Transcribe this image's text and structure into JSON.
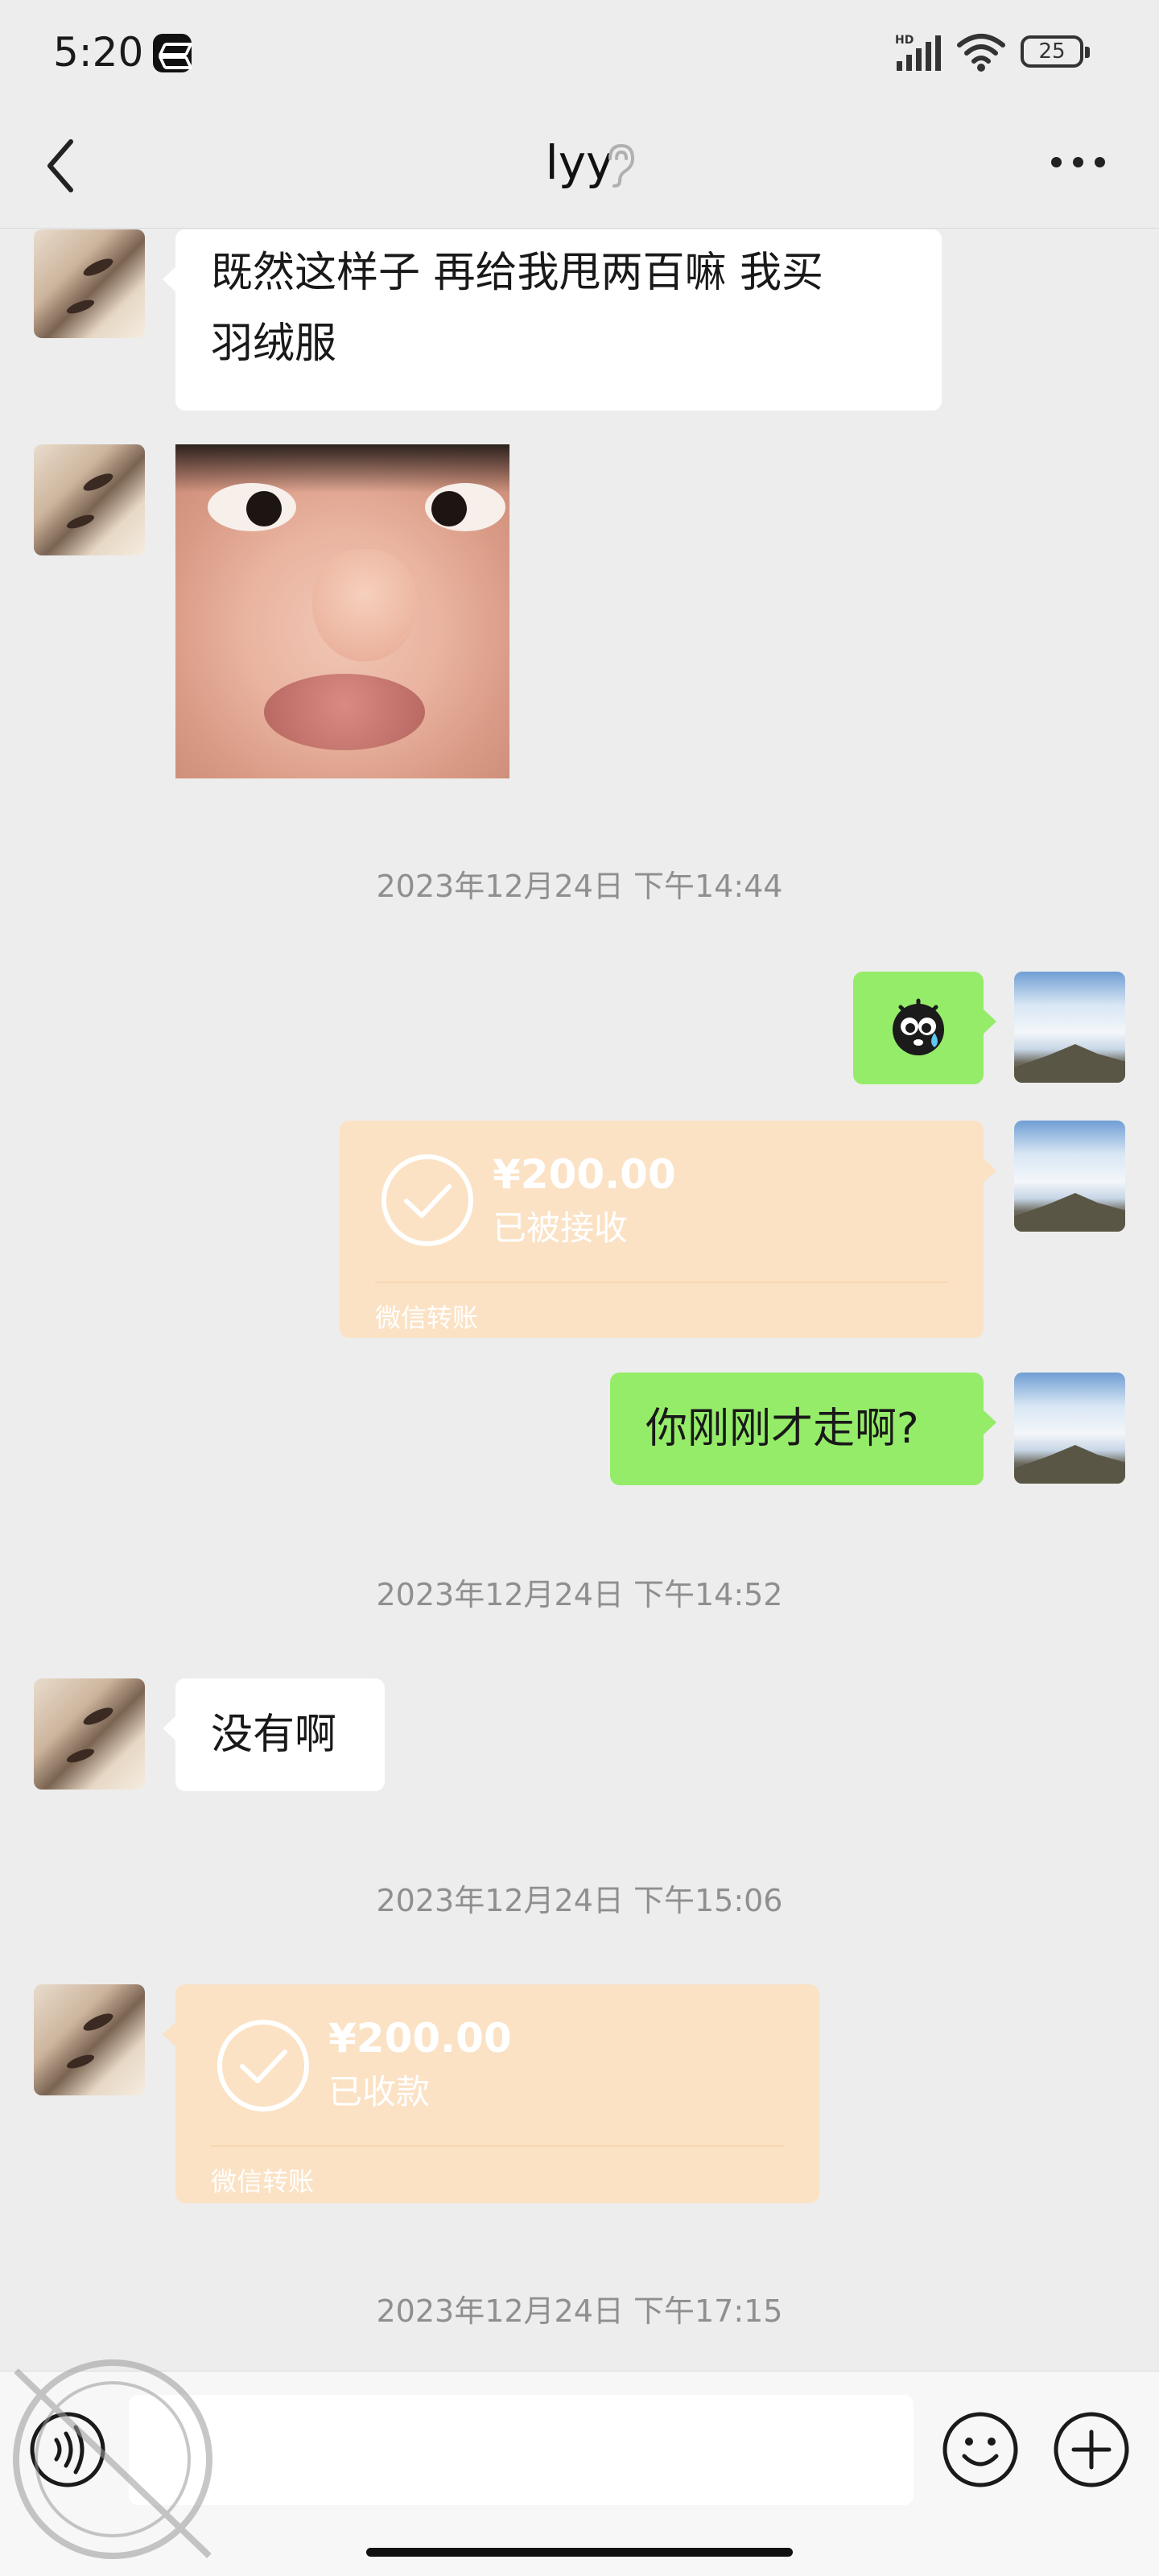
{
  "status_bar": {
    "time": "5:20",
    "battery": "25",
    "network": "HD",
    "icons": [
      "capcut-icon",
      "signal-icon",
      "wifi-icon",
      "battery-icon"
    ]
  },
  "header": {
    "title": "lyy",
    "icons": [
      "back-arrow-icon",
      "ear-icon",
      "more-icon"
    ]
  },
  "messages": [
    {
      "side": "left",
      "type": "text",
      "text_line1": "既然这样子  再给我甩两百嘛 我买",
      "text_line2": "羽绒服"
    },
    {
      "side": "left",
      "type": "image",
      "description": "sticker-photo"
    },
    {
      "type": "timestamp",
      "text": "2023年12月24日 下午14:44"
    },
    {
      "side": "right",
      "type": "emoji",
      "icon": "crying-emoji-icon"
    },
    {
      "side": "right",
      "type": "transfer",
      "amount": "¥200.00",
      "status": "已被接收",
      "label": "微信转账"
    },
    {
      "side": "right",
      "type": "text",
      "text": "你刚刚才走啊?"
    },
    {
      "type": "timestamp",
      "text": "2023年12月24日 下午14:52"
    },
    {
      "side": "left",
      "type": "text",
      "text": "没有啊"
    },
    {
      "type": "timestamp",
      "text": "2023年12月24日 下午15:06"
    },
    {
      "side": "left",
      "type": "transfer",
      "amount": "¥200.00",
      "status": "已收款",
      "label": "微信转账"
    },
    {
      "type": "timestamp",
      "text": "2023年12月24日 下午17:15"
    }
  ],
  "input_bar": {
    "icons": [
      "voice-icon",
      "emoji-icon",
      "plus-icon"
    ],
    "value": ""
  },
  "colors": {
    "background": "#ededed",
    "sent_bubble": "#95ec69",
    "received_bubble": "#ffffff",
    "transfer_card": "#fbe2c5"
  }
}
